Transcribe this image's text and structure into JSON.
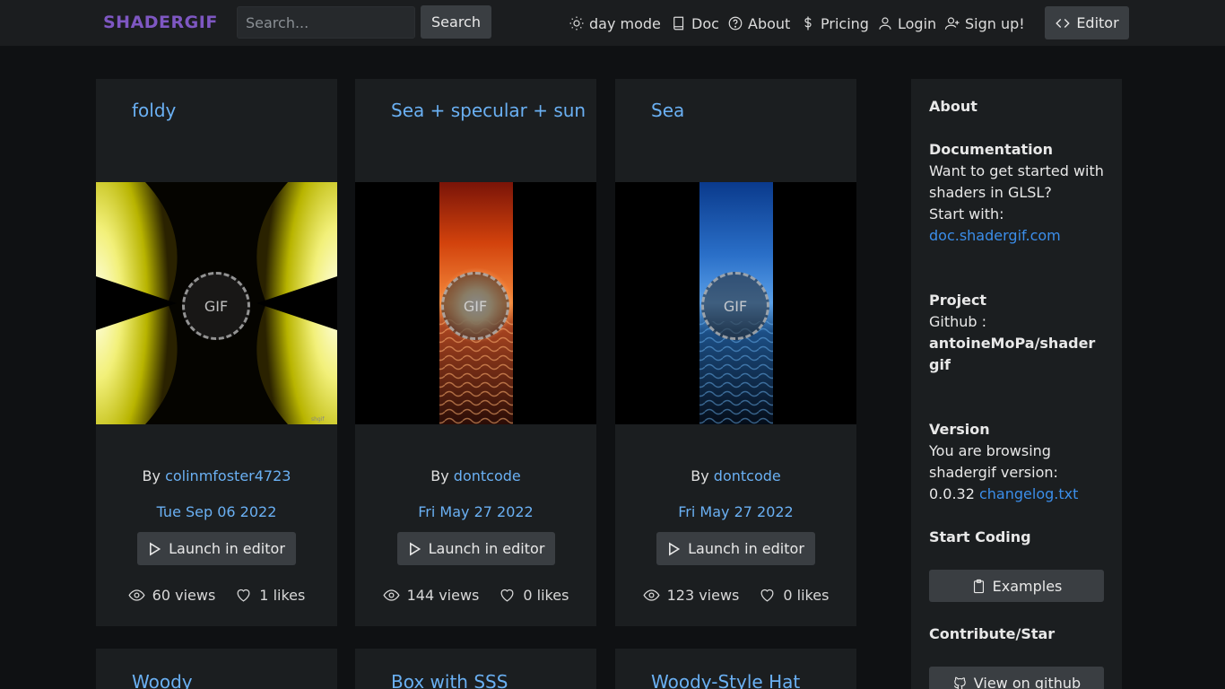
{
  "nav": {
    "brand": "SHADERGIF",
    "search_placeholder": "Search...",
    "search_button": "Search",
    "day_mode": "day mode",
    "doc": "Doc",
    "about": "About",
    "pricing": "Pricing",
    "login": "Login",
    "signup": "Sign up!",
    "editor": "Editor"
  },
  "cards": [
    {
      "title": "foldy",
      "by_prefix": "By",
      "author": "colinmfoster4723",
      "date": "Tue Sep 06 2022",
      "launch": "Launch in editor",
      "views": "60 views",
      "likes": "1 likes",
      "badge": "GIF"
    },
    {
      "title": "Sea + specular + sun",
      "by_prefix": "By",
      "author": "dontcode",
      "date": "Fri May 27 2022",
      "launch": "Launch in editor",
      "views": "144 views",
      "likes": "0 likes",
      "badge": "GIF"
    },
    {
      "title": "Sea",
      "by_prefix": "By",
      "author": "dontcode",
      "date": "Fri May 27 2022",
      "launch": "Launch in editor",
      "views": "123 views",
      "likes": "0 likes",
      "badge": "GIF"
    },
    {
      "title": "Woody"
    },
    {
      "title": "Box with SSS"
    },
    {
      "title": "Woody-Style Hat"
    }
  ],
  "sidebar": {
    "about": "About",
    "documentation": "Documentation",
    "doc_text_1": "Want to get started with",
    "doc_text_2": "shaders in GLSL?",
    "doc_text_3": "Start with:",
    "doc_link": "doc.shadergif.com",
    "project": "Project",
    "github_label": "Github :",
    "repo_1": "antoineMoPa/shader",
    "repo_2": "gif",
    "version": "Version",
    "version_text_1": "You are browsing",
    "version_text_2": "shadergif version:",
    "version_number": "0.0.32",
    "changelog": "changelog.txt",
    "start_coding": "Start Coding",
    "examples": "Examples",
    "contribute": "Contribute/Star",
    "view_github": "View on github"
  }
}
